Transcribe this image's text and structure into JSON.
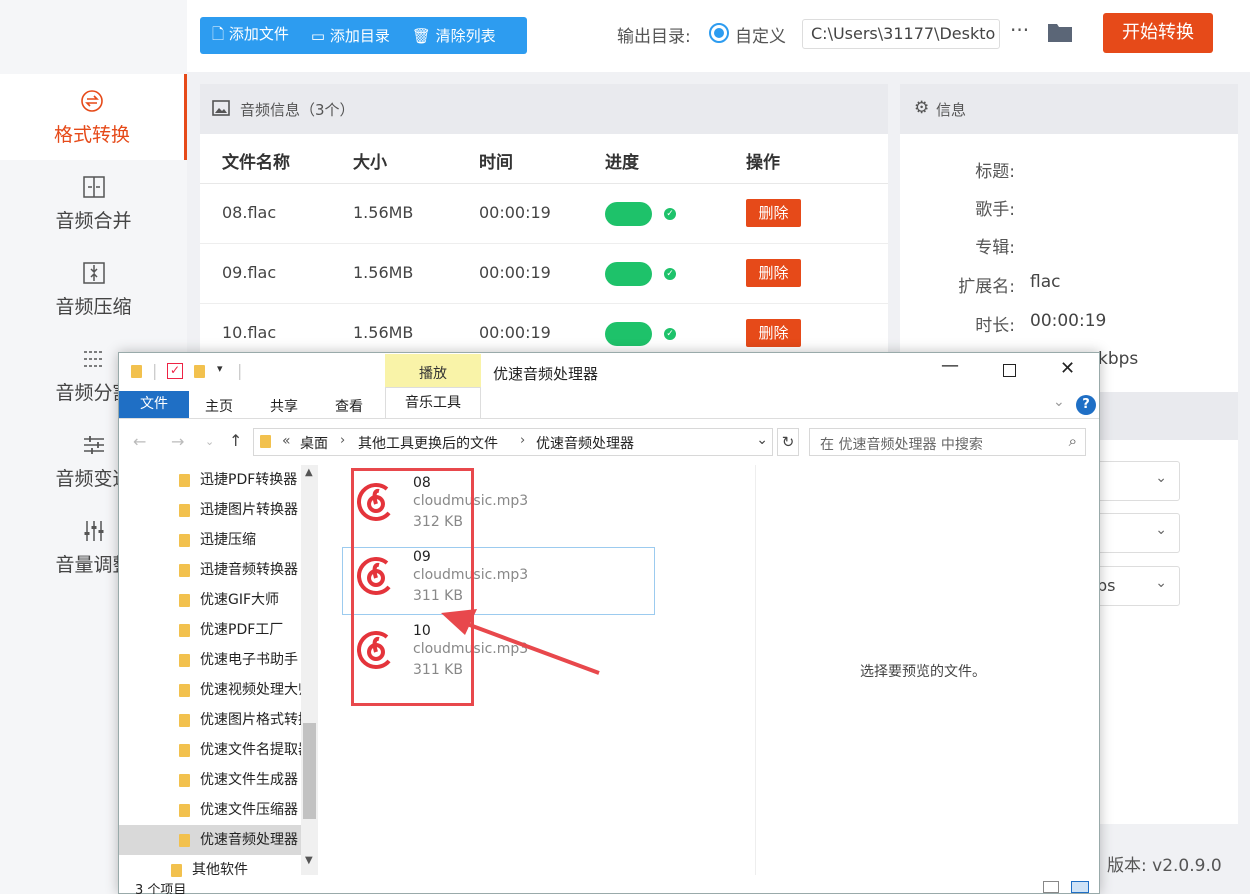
{
  "toolbar": {
    "add_file": "添加文件",
    "add_dir": "添加目录",
    "clear_list": "清除列表",
    "output_label": "输出目录:",
    "custom_label": "自定义",
    "path_value": "C:\\Users\\31177\\Deskto",
    "more": "···",
    "start_button": "开始转换"
  },
  "sidebar": {
    "items": [
      {
        "label": "格式转换",
        "icon": "format-convert-icon"
      },
      {
        "label": "音频合并",
        "icon": "merge-icon"
      },
      {
        "label": "音频压缩",
        "icon": "compress-icon"
      },
      {
        "label": "音频分割",
        "icon": "split-icon"
      },
      {
        "label": "音频变速",
        "icon": "speed-icon"
      },
      {
        "label": "音量调整",
        "icon": "volume-icon"
      }
    ]
  },
  "audio_panel": {
    "title": "音频信息（3个）",
    "columns": [
      "文件名称",
      "大小",
      "时间",
      "进度",
      "操作"
    ],
    "rows": [
      {
        "name": "08.flac",
        "size": "1.56MB",
        "time": "00:00:19",
        "action": "删除"
      },
      {
        "name": "09.flac",
        "size": "1.56MB",
        "time": "00:00:19",
        "action": "删除"
      },
      {
        "name": "10.flac",
        "size": "1.56MB",
        "time": "00:00:19",
        "action": "删除"
      }
    ]
  },
  "info_panel": {
    "title": "信息",
    "fields": [
      {
        "label": "标题:",
        "value": ""
      },
      {
        "label": "歌手:",
        "value": ""
      },
      {
        "label": "专辑:",
        "value": ""
      },
      {
        "label": "扩展名:",
        "value": "flac"
      },
      {
        "label": "时长:",
        "value": "00:00:19"
      }
    ],
    "bitrate_partial": "kbps",
    "select3_partial": "ps"
  },
  "version": "，版本: v2.0.9.0",
  "explorer": {
    "title": "优速音频处理器",
    "play_tab": "播放",
    "music_tools_tab": "音乐工具",
    "ribbon_tabs": [
      "文件",
      "主页",
      "共享",
      "查看"
    ],
    "breadcrumb": [
      "桌面",
      "其他工具更换后的文件",
      "优速音频处理器"
    ],
    "breadcrumb_prefix": "«",
    "search_placeholder": "在 优速音频处理器 中搜索",
    "tree": [
      "迅捷PDF转换器",
      "迅捷图片转换器",
      "迅捷压缩",
      "迅捷音频转换器",
      "优速GIF大师",
      "优速PDF工厂",
      "优速电子书助手",
      "优速视频处理大师",
      "优速图片格式转换器",
      "优速文件名提取器",
      "优速文件生成器",
      "优速文件压缩器",
      "优速音频处理器",
      "其他软件"
    ],
    "files": [
      {
        "name": "08",
        "type": "cloudmusic.mp3",
        "size": "312 KB"
      },
      {
        "name": "09",
        "type": "cloudmusic.mp3",
        "size": "311 KB"
      },
      {
        "name": "10",
        "type": "cloudmusic.mp3",
        "size": "311 KB"
      }
    ],
    "preview_text": "选择要预览的文件。",
    "status": "3 个项目"
  },
  "colors": {
    "accent": "#e64a19",
    "blue": "#2d9cf0",
    "green": "#1ec26a",
    "highlight_box": "#e8484c"
  }
}
